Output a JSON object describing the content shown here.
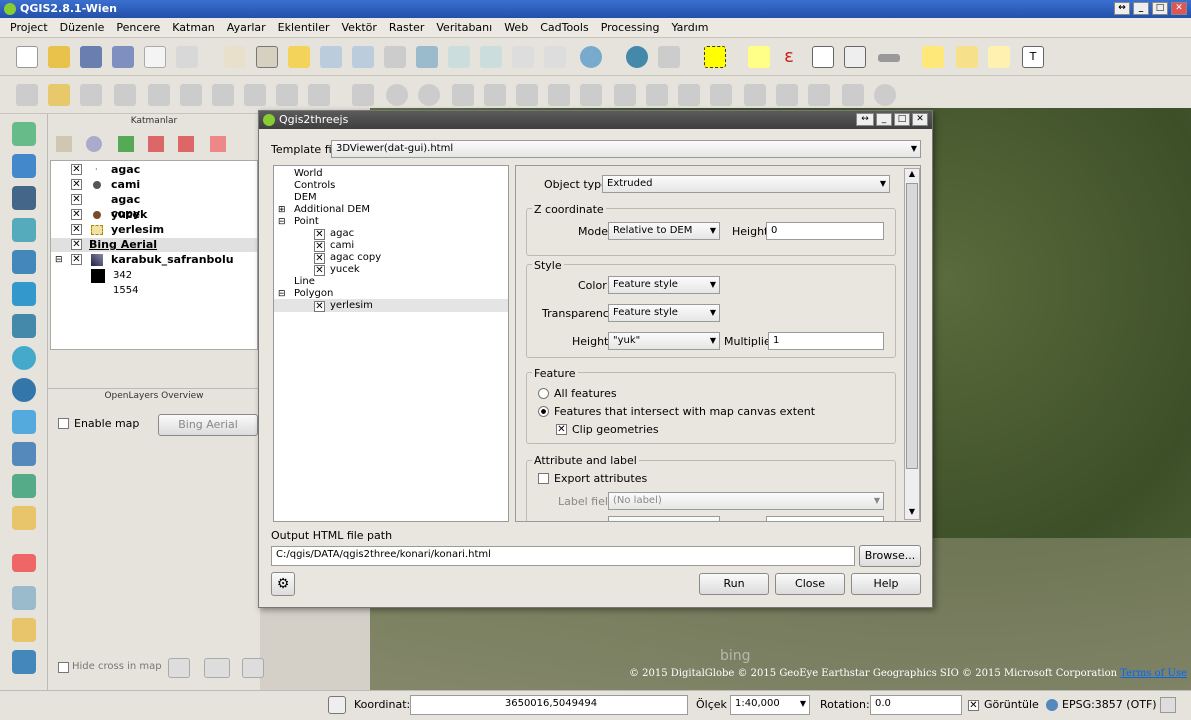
{
  "app": {
    "title": "QGIS2.8.1-Wien"
  },
  "menu": [
    "Project",
    "Düzenle",
    "Pencere",
    "Katman",
    "Ayarlar",
    "Eklentiler",
    "Vektör",
    "Raster",
    "Veritabanı",
    "Web",
    "CadTools",
    "Processing",
    "Yardım"
  ],
  "layers_panel": {
    "title": "Katmanlar",
    "items": [
      {
        "name": "agac",
        "checked": true
      },
      {
        "name": "cami",
        "checked": true
      },
      {
        "name": "agac copy",
        "checked": true
      },
      {
        "name": "yucek",
        "checked": true
      },
      {
        "name": "yerlesim",
        "checked": true
      },
      {
        "name": "Bing Aerial",
        "checked": true
      },
      {
        "name": "karabuk_safranbolu",
        "checked": true
      }
    ],
    "legend_values": [
      "342",
      "1554"
    ]
  },
  "openlayers": {
    "title": "OpenLayers Overview",
    "enable_label": "Enable map",
    "layer_button": "Bing Aerial"
  },
  "hide_cross": "Hide cross in map",
  "dialog": {
    "title": "Qgis2threejs",
    "template_label": "Template file",
    "template_value": "3DViewer(dat-gui).html",
    "tree": {
      "world": "World",
      "controls": "Controls",
      "dem": "DEM",
      "additional_dem": "Additional DEM",
      "point": "Point",
      "points": [
        "agac",
        "cami",
        "agac copy",
        "yucek"
      ],
      "line": "Line",
      "polygon": "Polygon",
      "polygons": [
        "yerlesim"
      ]
    },
    "object_type_label": "Object type",
    "object_type_value": "Extruded",
    "z_coord_title": "Z coordinate",
    "mode_label": "Mode",
    "mode_value": "Relative to DEM",
    "height_label": "Height",
    "height_value": "0",
    "style_title": "Style",
    "color_label": "Color",
    "color_value": "Feature style",
    "transparency_label": "Transparency",
    "transparency_value": "Feature style",
    "style_height_label": "Height",
    "style_height_value": "\"yuk\"",
    "multiplier_label": "Multiplier",
    "multiplier_value": "1",
    "feature_title": "Feature",
    "all_features": "All features",
    "intersect_features": "Features that intersect with map canvas extent",
    "clip_geometries": "Clip geometries",
    "attr_title": "Attribute and label",
    "export_attributes": "Export attributes",
    "label_field_label": "Label field",
    "label_field_value": "(No label)",
    "output_label": "Output HTML file path",
    "output_value": "C:/qgis/DATA/qgis2three/konari/konari.html",
    "browse": "Browse...",
    "run": "Run",
    "close": "Close",
    "help": "Help"
  },
  "map": {
    "watermark": "bing",
    "attribution": "© 2015 DigitalGlobe © 2015 GeoEye Earthstar Geographics SIO © 2015 Microsoft Corporation",
    "terms": "Terms of Use"
  },
  "status": {
    "coord_label": "Koordinat:",
    "coord_value": "3650016,5049494",
    "scale_label": "Ölçek",
    "scale_value": "1:40,000",
    "rotation_label": "Rotation:",
    "rotation_value": "0.0",
    "render_label": "Görüntüle",
    "crs": "EPSG:3857 (OTF)"
  },
  "colors": {
    "accent": "#2450a8",
    "dialog_title": "#4a4a4a"
  }
}
